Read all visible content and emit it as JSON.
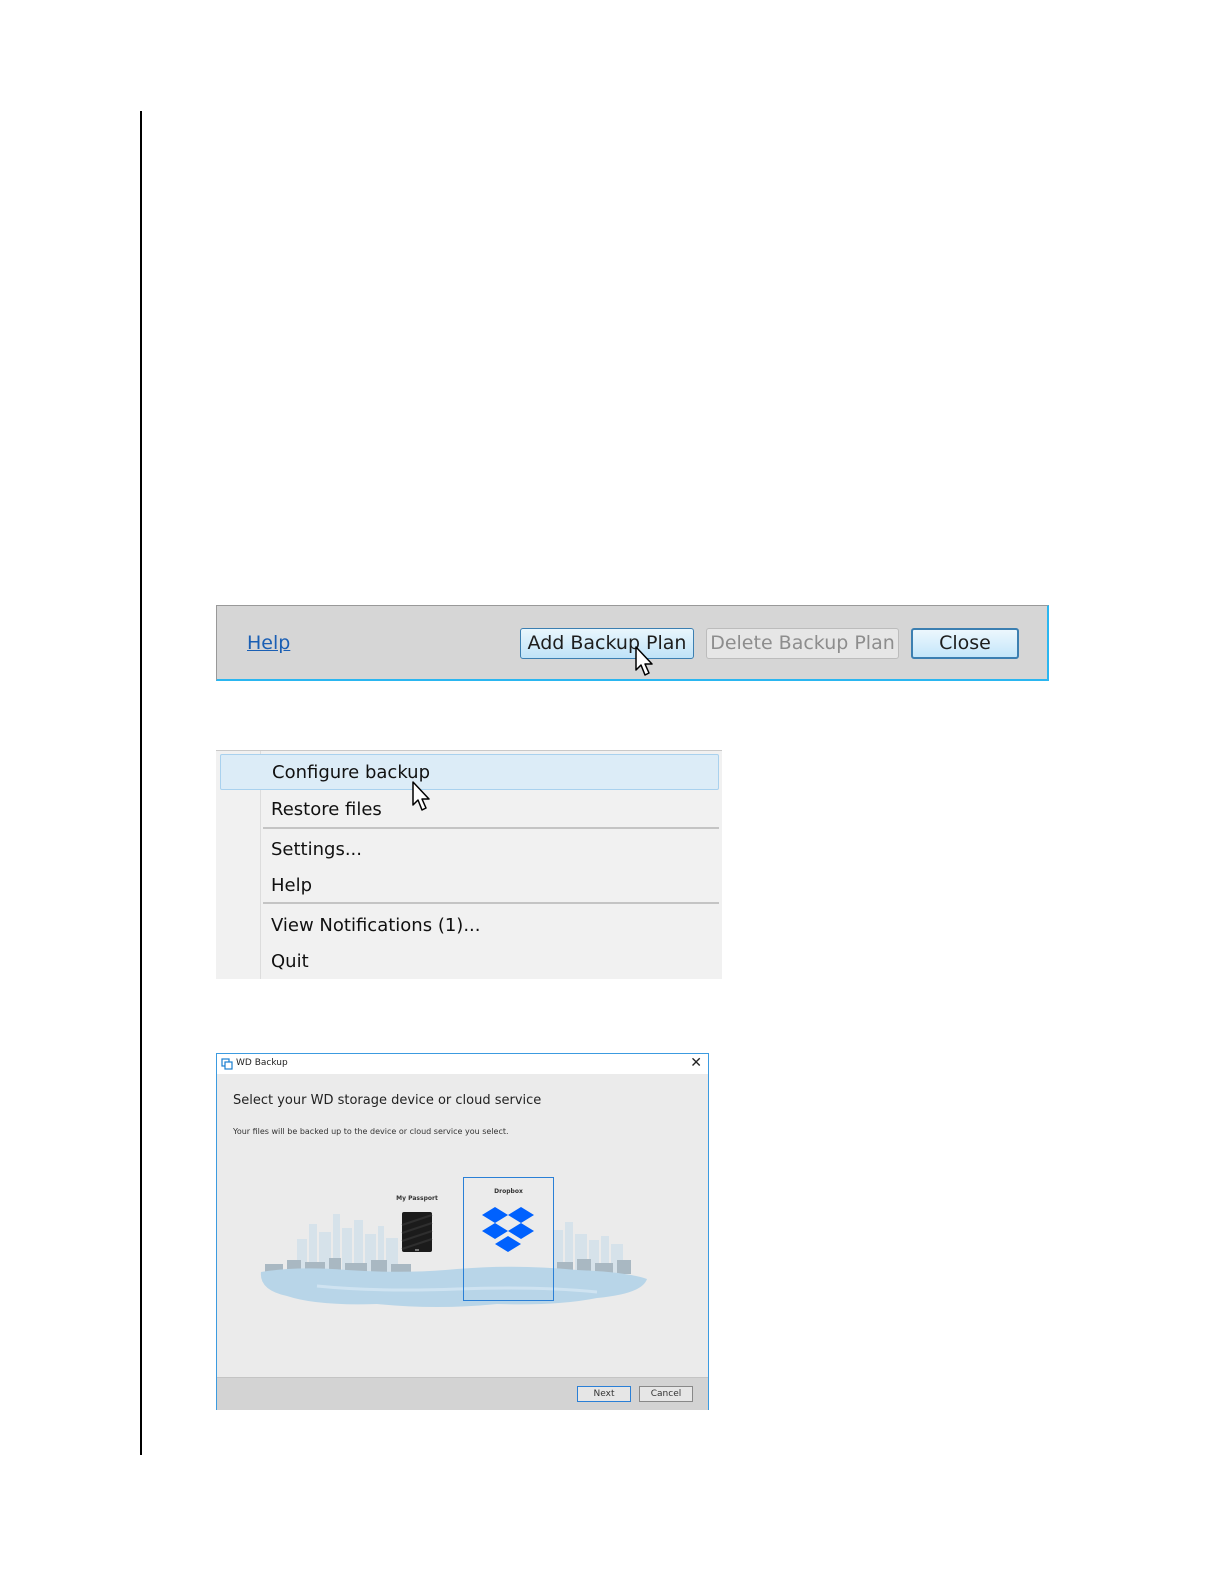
{
  "button_bar": {
    "help_link": "Help",
    "add_backup_plan": "Add Backup Plan",
    "delete_backup_plan": "Delete Backup Plan",
    "close": "Close"
  },
  "context_menu": {
    "items": [
      "Configure backup",
      "Restore files",
      "Settings...",
      "Help",
      "View Notifications (1)...",
      "Quit"
    ],
    "highlighted": "Configure backup"
  },
  "dialog": {
    "title": "WD Backup",
    "close_icon": "close-icon",
    "heading": "Select your WD storage device or cloud service",
    "subtext": "Your files will be backed up to the device or cloud service you select.",
    "devices": [
      {
        "label": "My Passport",
        "icon": "hard-drive-icon",
        "selected": false
      },
      {
        "label": "Dropbox",
        "icon": "dropbox-logo-icon",
        "selected": true
      }
    ],
    "next_button": "Next",
    "cancel_button": "Cancel"
  },
  "colors": {
    "accent_blue": "#2ab6f0",
    "dropbox_blue": "#0061fe",
    "selection_border": "#2a7fd6"
  }
}
